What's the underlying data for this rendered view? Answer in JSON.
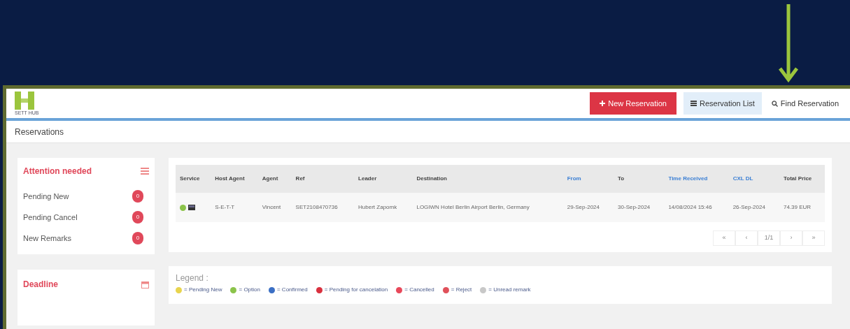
{
  "header": {
    "logo_text": "SETT HUB",
    "buttons": [
      {
        "kind": "primary",
        "label": "New Reservation"
      },
      {
        "kind": "light",
        "label": "Reservation List"
      },
      {
        "kind": "plain",
        "label": "Find Reservation"
      }
    ]
  },
  "page_title": "Reservations",
  "attention": {
    "title": "Attention needed",
    "items": [
      {
        "label": "Pending New",
        "count": "0"
      },
      {
        "label": "Pending Cancel",
        "count": "0"
      },
      {
        "label": "New Remarks",
        "count": "0"
      }
    ]
  },
  "deadline": {
    "title": "Deadline"
  },
  "table": {
    "columns": [
      {
        "label": "Service",
        "sortable": false
      },
      {
        "label": "Host Agent",
        "sortable": false
      },
      {
        "label": "Agent",
        "sortable": false
      },
      {
        "label": "Ref",
        "sortable": false
      },
      {
        "label": "Leader",
        "sortable": false
      },
      {
        "label": "Destination",
        "sortable": false
      },
      {
        "label": "From",
        "sortable": true
      },
      {
        "label": "To",
        "sortable": false
      },
      {
        "label": "Time Received",
        "sortable": true
      },
      {
        "label": "CXL DL",
        "sortable": true
      },
      {
        "label": "Total Price",
        "sortable": false
      }
    ],
    "rows": [
      {
        "color": "#8bc34a",
        "cells": [
          "",
          "S-E-T-T",
          "Vincent",
          "SET2108470736",
          "Hubert Zapomk",
          "LOGIWN Hotel Berlin Airport Berlin, Germany",
          "29-Sep-2024",
          "30-Sep-2024",
          "14/08/2024 15:46",
          "26-Sep-2024",
          "74.39 EUR"
        ]
      }
    ],
    "pagination": [
      "«",
      "‹",
      "1/1",
      "›",
      "»"
    ]
  },
  "legend": {
    "title": "Legend :",
    "items": [
      {
        "color": "#e8d44d",
        "label": "= Pending New"
      },
      {
        "color": "#8bc34a",
        "label": "= Option"
      },
      {
        "color": "#3b6fc4",
        "label": "= Confirmed"
      },
      {
        "color": "#d9303e",
        "label": "= Pending for cancelation"
      },
      {
        "color": "#e8485a",
        "label": "= Cancelled"
      },
      {
        "color": "#e0505a",
        "label": "= Reject"
      },
      {
        "color": "#c8c8c8",
        "label": "= Unread remark"
      }
    ]
  }
}
